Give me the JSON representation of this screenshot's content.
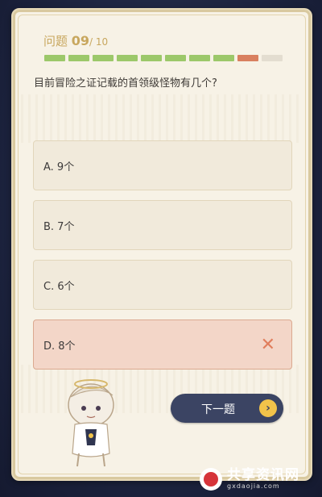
{
  "quiz": {
    "header": {
      "label": "问题 ",
      "current": "09",
      "total": "/ 10"
    },
    "progress": {
      "segments": [
        "done",
        "done",
        "done",
        "done",
        "done",
        "done",
        "done",
        "done",
        "wrong",
        "pending"
      ],
      "colors": {
        "done": "#9cc86a",
        "wrong": "#d9805f",
        "pending": "#e3ddd0"
      }
    },
    "question": "目前冒险之证记载的首领级怪物有几个?",
    "options": [
      {
        "label": "A. 9个",
        "state": "normal"
      },
      {
        "label": "B. 7个",
        "state": "normal"
      },
      {
        "label": "C. 6个",
        "state": "normal"
      },
      {
        "label": "D. 8个",
        "state": "wrong"
      }
    ],
    "wrong_icon": "close-icon",
    "next_button": {
      "label": "下一题",
      "icon": "chevron-right-icon"
    }
  },
  "watermark": {
    "title": "共享资讯网",
    "url": "gxdaojia.com"
  }
}
